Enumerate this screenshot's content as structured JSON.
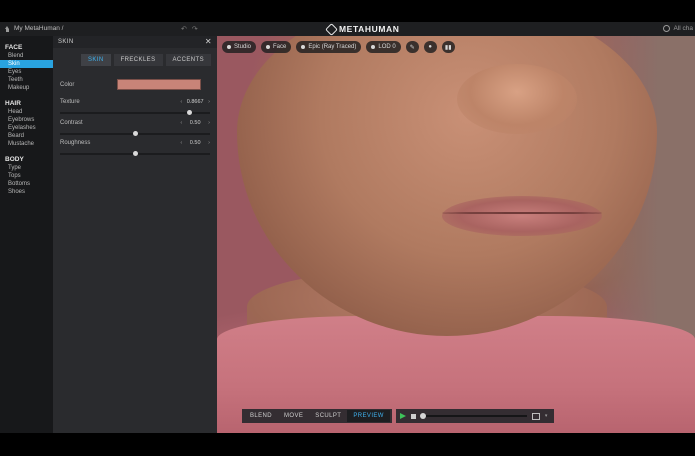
{
  "topbar": {
    "breadcrumb": "My MetaHuman /",
    "undo_glyph": "↶",
    "redo_glyph": "↷",
    "logo": "METAHUMAN",
    "right_text": "All cha"
  },
  "sidebar": {
    "categories": [
      {
        "label": "FACE",
        "items": [
          "Blend",
          "Skin",
          "Eyes",
          "Teeth",
          "Makeup"
        ]
      },
      {
        "label": "HAIR",
        "items": [
          "Head",
          "Eyebrows",
          "Eyelashes",
          "Beard",
          "Mustache"
        ]
      },
      {
        "label": "BODY",
        "items": [
          "Type",
          "Tops",
          "Bottoms",
          "Shoes"
        ]
      }
    ],
    "active_item": "Skin"
  },
  "panel": {
    "title": "SKIN",
    "close_glyph": "✕",
    "tabs": [
      "SKIN",
      "FRECKLES",
      "ACCENTS"
    ],
    "active_tab": "SKIN",
    "color": {
      "label": "Color",
      "value": "#c88478"
    },
    "sliders": [
      {
        "label": "Texture",
        "value": "0.8667",
        "level": 0.86
      },
      {
        "label": "Contrast",
        "value": "0.50",
        "level": 0.5
      },
      {
        "label": "Roughness",
        "value": "0.50",
        "level": 0.5
      }
    ],
    "stepper_left": "‹",
    "stepper_right": "›"
  },
  "viewport": {
    "toolbar": {
      "studio": "Studio",
      "face": "Face",
      "quality": "Epic (Ray Traced)",
      "lod": "LOD 0"
    },
    "modes": [
      "BLEND",
      "MOVE",
      "SCULPT",
      "PREVIEW"
    ],
    "active_mode": "PREVIEW",
    "timeline_position": 0.0
  }
}
